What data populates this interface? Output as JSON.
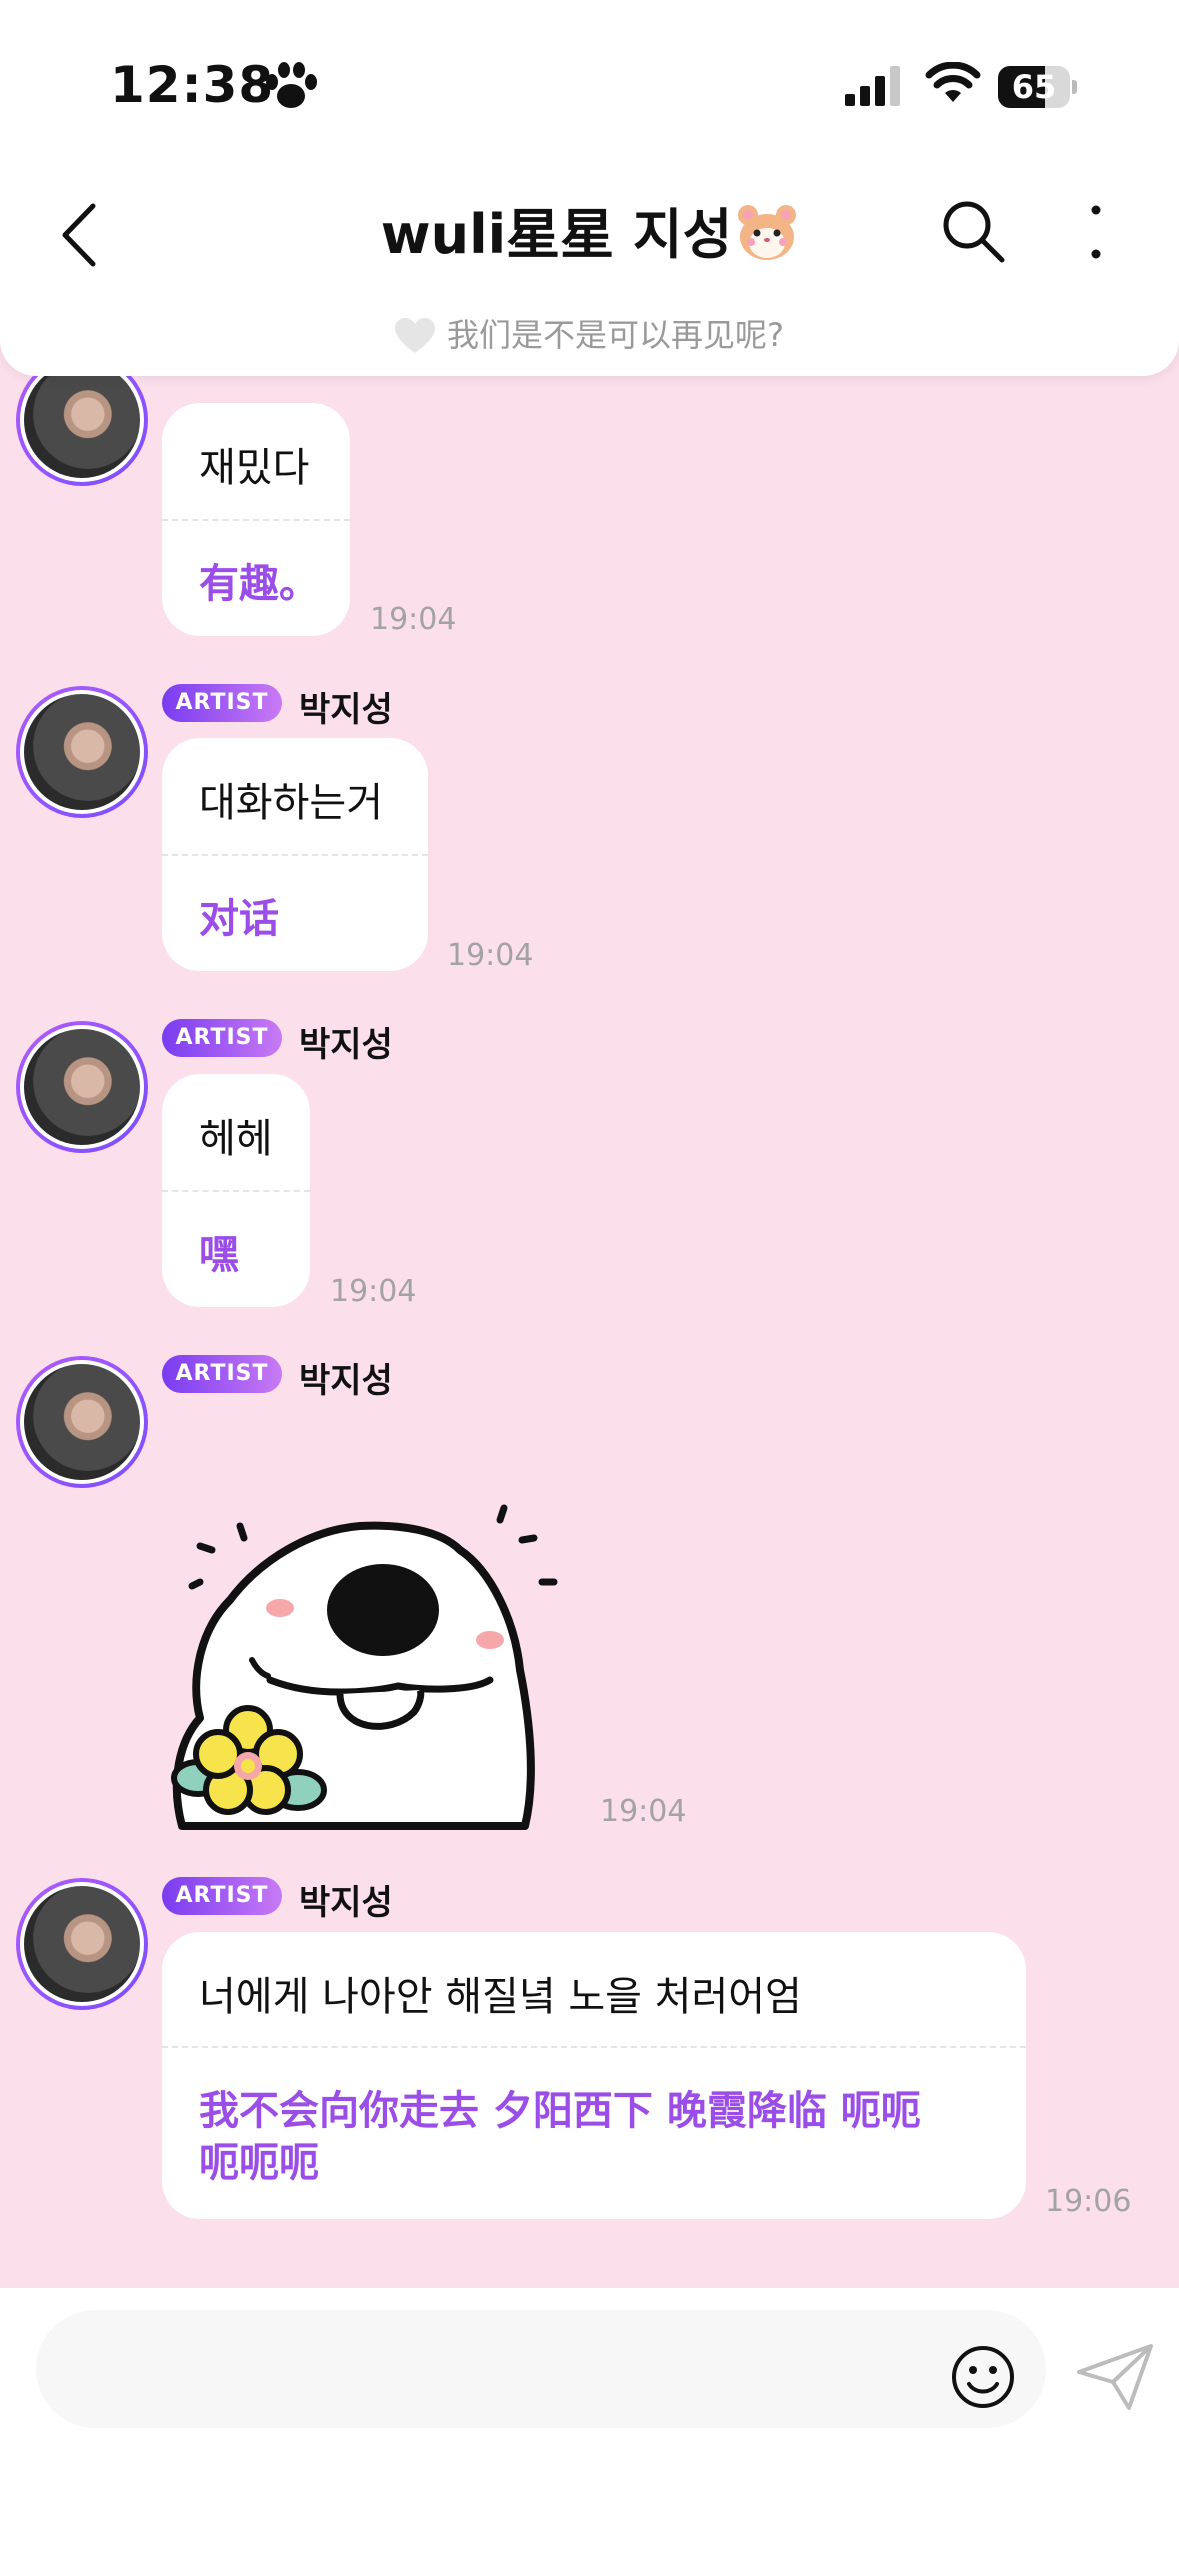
{
  "status_bar": {
    "time": "12:38",
    "battery": "65",
    "battery_level": 0.65
  },
  "header": {
    "title": "wuli星星 지성",
    "notice": "我们是不是可以再见呢?"
  },
  "messages": [
    {
      "korean": "재밌다",
      "translation": "有趣。",
      "time": "19:04"
    },
    {
      "badge": "ARTIST",
      "sender": "박지성",
      "korean": "대화하는거",
      "translation": "对话",
      "time": "19:04"
    },
    {
      "badge": "ARTIST",
      "sender": "박지성",
      "korean": "헤헤",
      "translation": "嘿",
      "time": "19:04"
    },
    {
      "badge": "ARTIST",
      "sender": "박지성",
      "time": "19:04"
    },
    {
      "badge": "ARTIST",
      "sender": "박지성",
      "korean": "너에게 나아안 해질녘 노을 처러어엄",
      "translation_line1": "我不会向你走去 夕阳西下 晚霞降临 呃呃",
      "translation_line2": "呃呃呃",
      "time": "19:06"
    }
  ],
  "icons": {
    "back": "chevron-left-icon",
    "search": "search-icon",
    "more": "more-vertical-icon",
    "heart": "heart-icon",
    "emoji": "smile-icon",
    "send": "send-icon"
  }
}
